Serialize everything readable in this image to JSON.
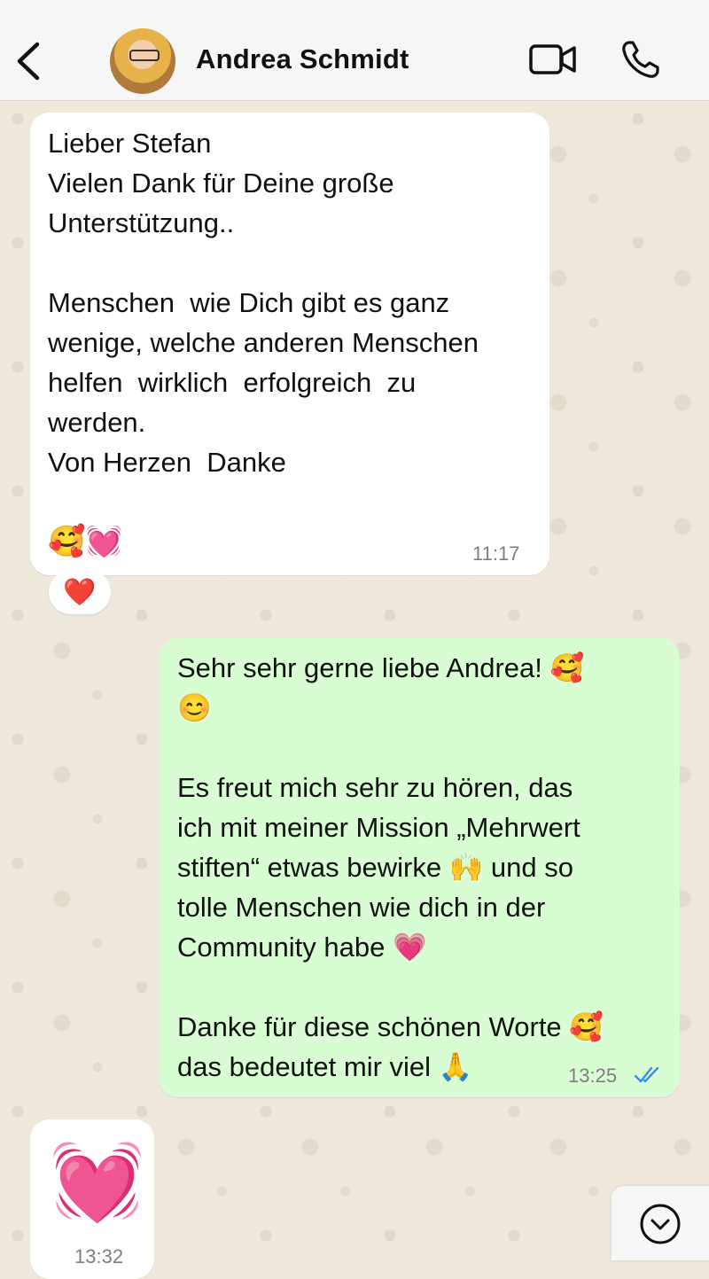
{
  "header": {
    "contact_name": "Andrea Schmidt",
    "back_icon": "chevron-left-icon",
    "video_icon": "video-camera-icon",
    "call_icon": "phone-icon"
  },
  "messages": [
    {
      "direction": "incoming",
      "text": "Lieber Stefan\nVielen Dank für Deine große\nUnterstützung..\n\nMenschen  wie Dich gibt es ganz\nwenige, welche anderen Menschen\nhelfen  wirklich  erfolgreich  zu\nwerden.\nVon Herzen  Danke\n\n",
      "emojis": "🥰💓",
      "time": "11:17",
      "reaction": "❤️"
    },
    {
      "direction": "outgoing",
      "text": "Sehr sehr gerne liebe Andrea! 🥰\n😊\n\nEs freut mich sehr zu hören, das\nich mit meiner Mission „Mehrwert\nstiften“ etwas bewirke 🙌 und so\ntolle Menschen wie dich in der\nCommunity habe 💗\n\nDanke für diese schönen Worte 🥰\ndas bedeutet mir viel 🙏",
      "time": "13:25",
      "status": "read"
    },
    {
      "direction": "incoming",
      "text": "💓",
      "time": "13:32"
    }
  ],
  "colors": {
    "outgoing_bubble": "#d9fdd3",
    "incoming_bubble": "#ffffff",
    "read_ticks": "#3b8ee8",
    "chat_background": "#efe8dd"
  },
  "scroll_icon": "chevron-down-circle-icon"
}
